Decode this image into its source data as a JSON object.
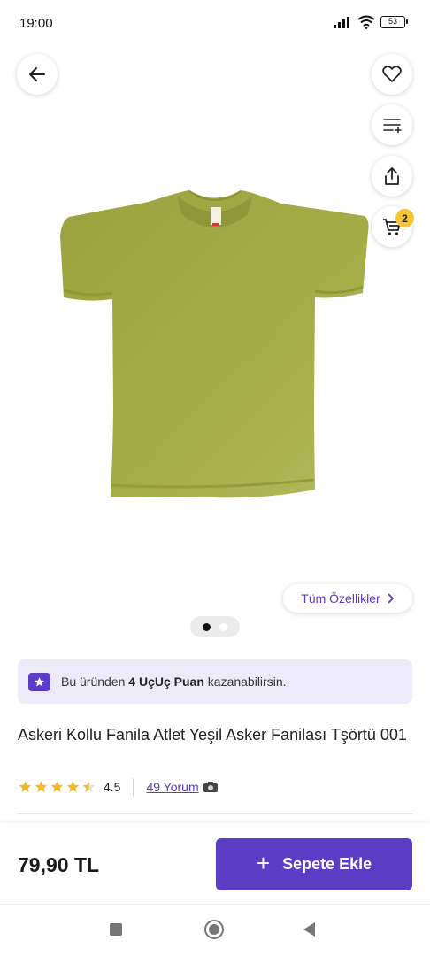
{
  "status_bar": {
    "time": "19:00",
    "battery": "53",
    "icons": [
      "signal-icon",
      "wifi-icon",
      "battery-icon"
    ]
  },
  "header_actions": {
    "icons": [
      "back-arrow-icon",
      "heart-icon",
      "filter-list-icon",
      "share-icon",
      "cart-icon"
    ],
    "cart_count": "2"
  },
  "gallery": {
    "features_label": "Tüm Özellikler",
    "image_count": 2,
    "active_index": 0,
    "shirt_color": "#a3ab45"
  },
  "points_banner": {
    "prefix": "Bu üründen ",
    "highlight": "4 UçUç Puan",
    "suffix": " kazanabilirsin."
  },
  "product": {
    "title": "Askeri Kollu Fanila Atlet Yeşil Asker Fanilası Tşörtü 001",
    "rating": "4.5",
    "rating_value": 4.5,
    "reviews": "49 Yorum",
    "price": "79,90 TL"
  },
  "actions": {
    "add_to_cart_label": "Sepete Ekle"
  },
  "colors": {
    "accent": "#5b3cc4",
    "badge": "#f6c532",
    "star": "#f6b91d",
    "banner_bg": "#eeebf8"
  },
  "nav_bar": {
    "icons": [
      "recents-icon",
      "home-icon",
      "nav-back-icon"
    ]
  }
}
